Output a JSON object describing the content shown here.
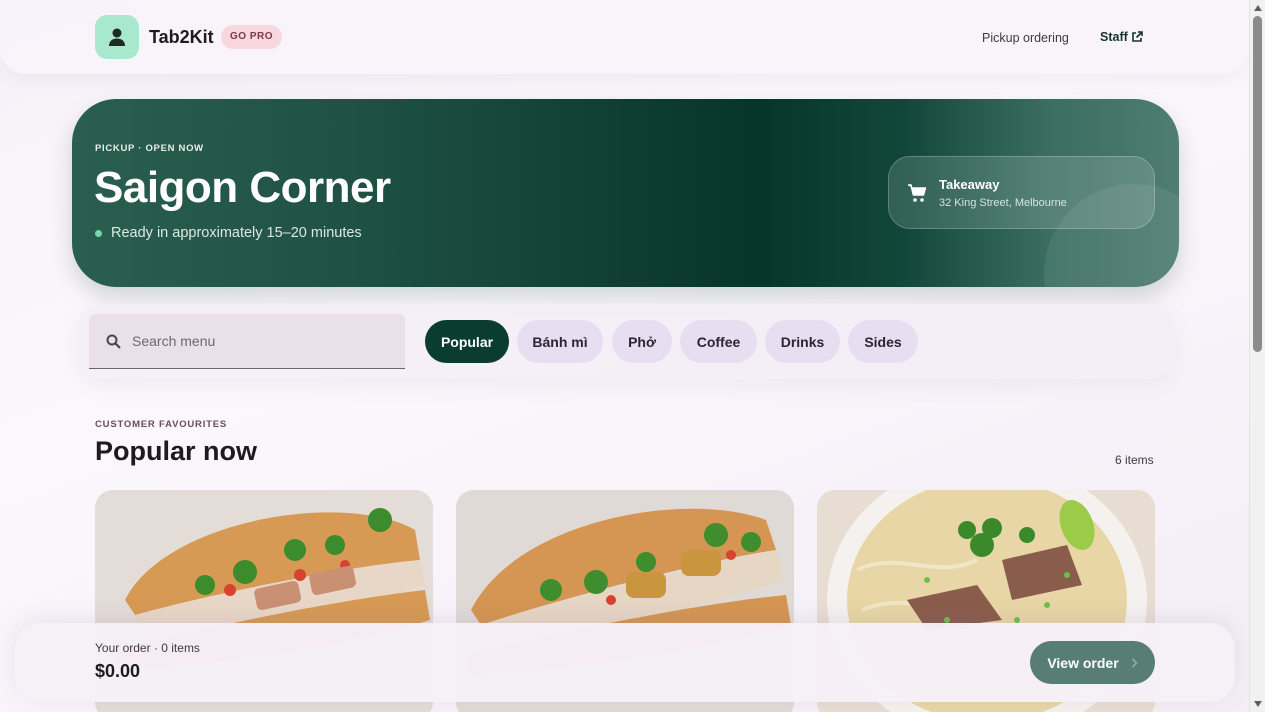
{
  "header": {
    "brand": "Tab2Kit",
    "pro_badge": "GO PRO",
    "nav_pickup": "Pickup ordering",
    "nav_staff": "Staff"
  },
  "hero": {
    "kicker": "PICKUP · OPEN NOW",
    "title": "Saigon Corner",
    "subtitle": "Ready in approximately 15–20 minutes",
    "takeaway_title": "Takeaway",
    "takeaway_address": "32 King Street, Melbourne"
  },
  "search": {
    "placeholder": "Search menu"
  },
  "categories": [
    {
      "label": "Popular",
      "active": true
    },
    {
      "label": "Bánh mì",
      "active": false
    },
    {
      "label": "Phở",
      "active": false
    },
    {
      "label": "Coffee",
      "active": false
    },
    {
      "label": "Drinks",
      "active": false
    },
    {
      "label": "Sides",
      "active": false
    }
  ],
  "section": {
    "kicker": "CUSTOMER FAVOURITES",
    "title": "Popular now",
    "count": "6 items"
  },
  "order": {
    "label": "Your order · 0 items",
    "total": "$0.00",
    "button": "View order"
  },
  "colors": {
    "brand_dark": "#0a3d2e",
    "chip_bg": "#e8def2",
    "logo_bg": "#a8e8cf",
    "button": "#587d73"
  },
  "icons": [
    "user-icon",
    "external-link-icon",
    "cart-icon",
    "search-icon",
    "chevron-right-icon"
  ]
}
